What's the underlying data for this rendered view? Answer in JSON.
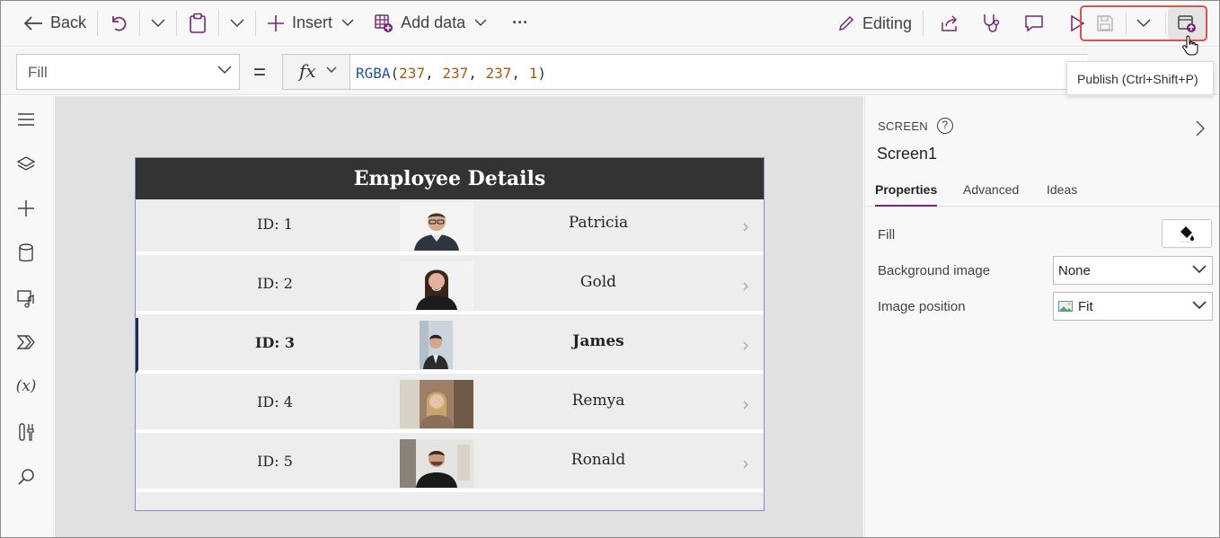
{
  "toolbar": {
    "back_label": "Back",
    "insert_label": "Insert",
    "add_data_label": "Add data",
    "more_label": "···",
    "editing_label": "Editing"
  },
  "formula_bar": {
    "property": "Fill",
    "equals": "=",
    "fx_label": "fx",
    "function": "RGBA",
    "open_paren": "(",
    "arg1": "237",
    "arg2": "237",
    "arg3": "237",
    "arg4": "1",
    "comma": ", ",
    "close_paren": ")"
  },
  "tooltip": {
    "text": "Publish (Ctrl+Shift+P)"
  },
  "app": {
    "header": "Employee Details",
    "rows": [
      {
        "id": "ID: 1",
        "name": "Patricia"
      },
      {
        "id": "ID: 2",
        "name": "Gold"
      },
      {
        "id": "ID: 3",
        "name": "James"
      },
      {
        "id": "ID: 4",
        "name": "Remya"
      },
      {
        "id": "ID: 5",
        "name": "Ronald"
      }
    ]
  },
  "right_panel": {
    "section": "SCREEN",
    "help": "?",
    "screen_name": "Screen1",
    "tabs": [
      "Properties",
      "Advanced",
      "Ideas"
    ],
    "fill_label": "Fill",
    "background_image_label": "Background image",
    "background_image_value": "None",
    "image_position_label": "Image position",
    "image_position_value": "Fit"
  },
  "colors": {
    "accent": "#742774",
    "header_bg": "#333333",
    "canvas_bg": "#e1e1e1",
    "selected_bar": "#1c2b6b",
    "highlight_box": "#d9534f"
  },
  "icons": [
    "back-arrow-icon",
    "undo-icon",
    "chevron-down-icon",
    "paste-icon",
    "plus-icon",
    "add-data-icon",
    "pencil-icon",
    "share-icon",
    "stethoscope-icon",
    "comment-icon",
    "play-icon",
    "save-icon",
    "publish-icon",
    "hamburger-icon",
    "layers-icon",
    "database-icon",
    "media-icon",
    "shapes-icon",
    "variables-icon",
    "tools-icon",
    "search-icon",
    "paint-bucket-icon",
    "image-icon",
    "chevron-right-icon",
    "cursor-hand-icon"
  ]
}
